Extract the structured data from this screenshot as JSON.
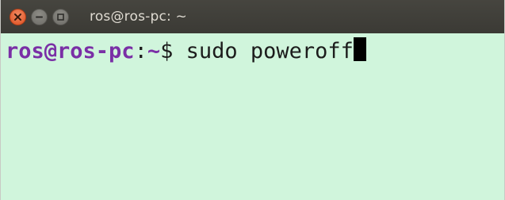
{
  "window": {
    "title": "ros@ros-pc: ~"
  },
  "terminal": {
    "user_host": "ros@ros-pc",
    "separator": ":",
    "path": "~",
    "prompt_symbol": "$ ",
    "command": "sudo poweroff"
  },
  "colors": {
    "terminal_background": "#d0f5dc",
    "prompt_color": "#7a2fa6",
    "titlebar": "#3e3d38",
    "close_button": "#e05a2b"
  },
  "icons": {
    "close": "close-icon",
    "minimize": "minimize-icon",
    "maximize": "maximize-icon"
  }
}
